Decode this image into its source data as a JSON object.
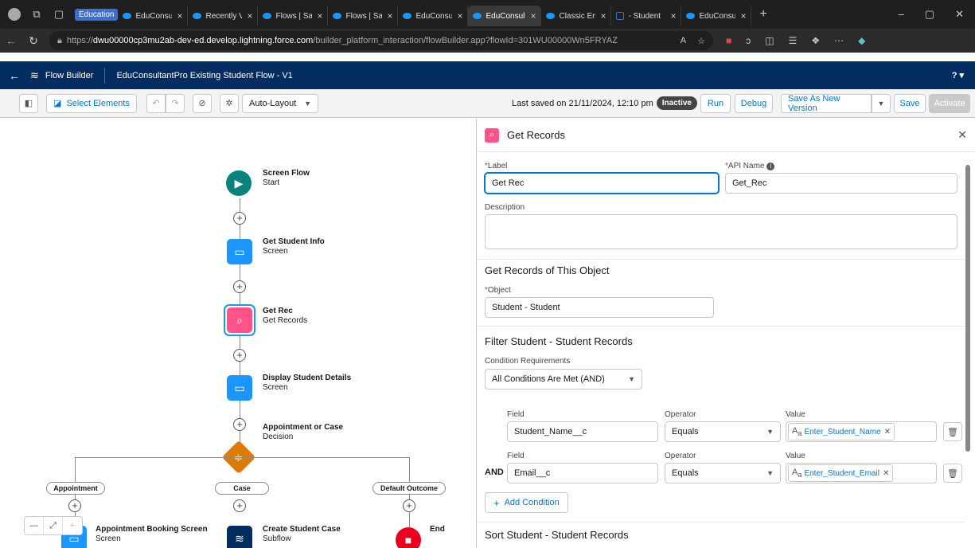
{
  "browser": {
    "group_label": "Education",
    "tabs": [
      {
        "title": "EduConsult",
        "active": false
      },
      {
        "title": "Recently Vi",
        "active": false
      },
      {
        "title": "Flows | Sale",
        "active": false
      },
      {
        "title": "Flows | Sale",
        "active": false
      },
      {
        "title": "EduConsult",
        "active": false
      },
      {
        "title": "EduConsult",
        "active": true
      },
      {
        "title": "Classic Ema",
        "active": false
      },
      {
        "title": "- Student",
        "active": false
      },
      {
        "title": "EduConsult",
        "active": false
      }
    ],
    "url_prefix": "https://",
    "url_host": "dwu00000cp3mu2ab-dev-ed.develop.lightning.force.com",
    "url_path": "/builder_platform_interaction/flowBuilder.app?flowId=301WU00000Wn5FRYAZ"
  },
  "header": {
    "app_name": "Flow Builder",
    "flow_title": "EduConsultantPro Existing Student Flow - V1",
    "help": "? ▾"
  },
  "toolbar": {
    "select_elements": "Select Elements",
    "layout": "Auto-Layout",
    "last_saved": "Last saved on 21/11/2024, 12:10 pm",
    "status": "Inactive",
    "run": "Run",
    "debug": "Debug",
    "save_as_new": "Save As New Version",
    "save": "Save",
    "activate": "Activate"
  },
  "canvas": {
    "start": {
      "title": "Screen Flow",
      "subtitle": "Start"
    },
    "get_student_info": {
      "title": "Get Student Info",
      "subtitle": "Screen"
    },
    "get_rec": {
      "title": "Get Rec",
      "subtitle": "Get Records"
    },
    "display_details": {
      "title": "Display Student Details",
      "subtitle": "Screen"
    },
    "decision": {
      "title": "Appointment or Case",
      "subtitle": "Decision"
    },
    "outcomes": [
      "Appointment",
      "Case",
      "Default Outcome"
    ],
    "appointment_screen": {
      "title": "Appointment Booking Screen",
      "subtitle": "Screen"
    },
    "create_case": {
      "title": "Create Student Case",
      "subtitle": "Subflow"
    },
    "end": {
      "title": "End"
    }
  },
  "panel": {
    "title": "Get Records",
    "label_field": {
      "label": "Label",
      "value": "Get Rec"
    },
    "api_field": {
      "label": "API Name",
      "value": "Get_Rec"
    },
    "description_label": "Description",
    "object_section": "Get Records of This Object",
    "object_label": "Object",
    "object_value": "Student - Student",
    "filter_section": "Filter Student - Student Records",
    "condition_req_label": "Condition Requirements",
    "condition_req_value": "All Conditions Are Met (AND)",
    "col_field": "Field",
    "col_operator": "Operator",
    "col_value": "Value",
    "rows": [
      {
        "prefix": "",
        "field": "Student_Name__c",
        "operator": "Equals",
        "value": "Enter_Student_Name"
      },
      {
        "prefix": "AND",
        "field": "Email__c",
        "operator": "Equals",
        "value": "Enter_Student_Email"
      }
    ],
    "add_condition": "Add Condition",
    "sort_section": "Sort Student - Student Records"
  },
  "colors": {
    "sf_navy": "#032d60",
    "brand_blue": "#0176d3",
    "screen_node": "#1b96ff",
    "records_node": "#ff538a",
    "start_node": "#0b827c",
    "decision_node": "#dd7a01",
    "end_node": "#ea001e"
  }
}
